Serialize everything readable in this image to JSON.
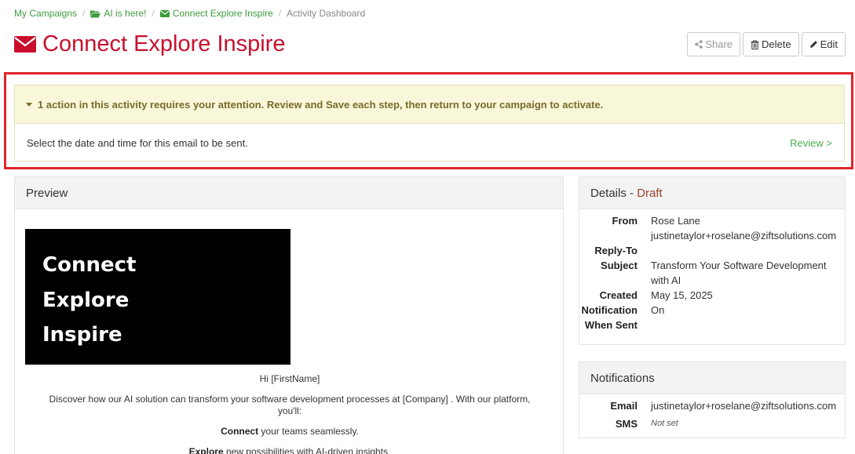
{
  "breadcrumb": {
    "items": [
      {
        "label": "My Campaigns",
        "icon": ""
      },
      {
        "label": "AI is here!",
        "icon": "folder-open-icon"
      },
      {
        "label": "Connect Explore Inspire",
        "icon": "envelope-icon"
      },
      {
        "label": "Activity Dashboard",
        "icon": ""
      }
    ]
  },
  "page": {
    "title": "Connect Explore Inspire",
    "title_icon": "envelope-icon"
  },
  "toolbar": {
    "share_label": "Share",
    "delete_label": "Delete",
    "edit_label": "Edit"
  },
  "alert": {
    "heading": "1 action in this activity requires your attention. Review and Save each step, then return to your campaign to activate.",
    "message": "Select the date and time for this email to be sent.",
    "link": "Review >"
  },
  "preview": {
    "header": "Preview",
    "hero_lines": [
      "Connect",
      "Explore",
      "Inspire"
    ],
    "greeting": "Hi [FirstName]",
    "intro": "Discover how our AI solution can transform your software development processes at [Company] . With our platform, you'll:",
    "bullet1_bold": "Connect",
    "bullet1_rest": " your teams seamlessly.",
    "bullet2_bold": "Explore",
    "bullet2_rest": " new possibilities with AI-driven insights."
  },
  "details": {
    "header_label": "Details",
    "header_sep": " - ",
    "status": "Draft",
    "from_label": "From",
    "from_name": "Rose Lane",
    "from_email": "justinetaylor+roselane@ziftsolutions.com",
    "replyto_label": "Reply-To",
    "subject_label": "Subject",
    "subject_line1": "Transform Your Software Development",
    "subject_line2": "with AI",
    "created_label": "Created",
    "created_value": "May 15, 2025",
    "notif_label1": "Notification",
    "notif_label2": "When Sent",
    "notif_value": "On"
  },
  "notifications": {
    "header": "Notifications",
    "email_label": "Email",
    "email_value": "justinetaylor+roselane@ziftsolutions.com",
    "sms_label": "SMS",
    "sms_value": "Not set"
  },
  "colors": {
    "title_red": "#c8102e",
    "link_green": "#3d9b3d",
    "alert_bg": "#f8f7da",
    "highlight_border": "#e0242c",
    "draft": "#a0412d"
  }
}
